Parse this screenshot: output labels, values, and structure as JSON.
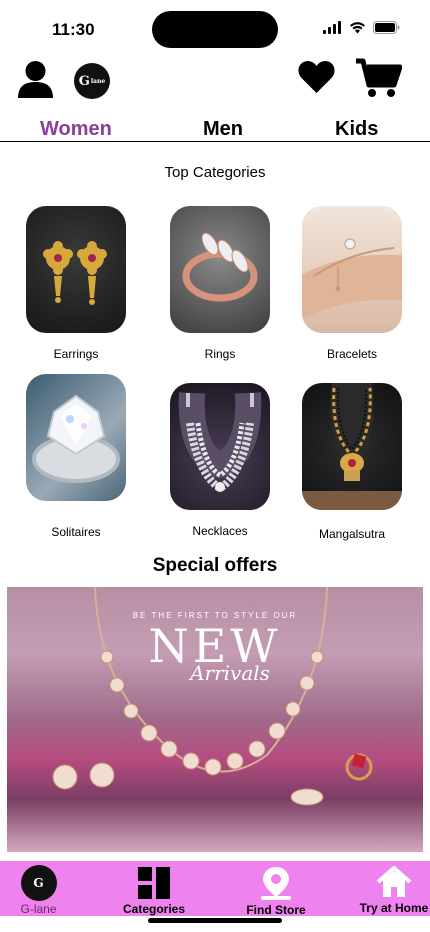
{
  "status_bar": {
    "time": "11:30"
  },
  "header": {
    "brand_logo_text": "G-lane",
    "icons": [
      "user-icon",
      "brand-logo",
      "heart-icon",
      "cart-icon"
    ]
  },
  "tabs": [
    {
      "label": "Women",
      "active": true,
      "color": "#8a3f99"
    },
    {
      "label": "Men",
      "active": false
    },
    {
      "label": "Kids",
      "active": false
    }
  ],
  "top_categories": {
    "title": "Top Categories",
    "items": [
      {
        "label": "Earrings"
      },
      {
        "label": "Rings"
      },
      {
        "label": "Bracelets"
      },
      {
        "label": "Solitaires"
      },
      {
        "label": "Necklaces"
      },
      {
        "label": "Mangalsutra"
      }
    ]
  },
  "special_offers": {
    "title": "Special offers",
    "banner": {
      "top_text": "BE THE FIRST TO STYLE OUR",
      "headline": "NEW",
      "subline": "Arrivals"
    }
  },
  "bottom_nav": {
    "background": "#ee82ee",
    "items": [
      {
        "label": "G-lane",
        "icon": "brand-logo-icon"
      },
      {
        "label": "Categories",
        "icon": "categories-icon"
      },
      {
        "label": "Find Store",
        "icon": "location-pin-icon"
      },
      {
        "label": "Try at Home",
        "icon": "home-icon"
      }
    ]
  }
}
